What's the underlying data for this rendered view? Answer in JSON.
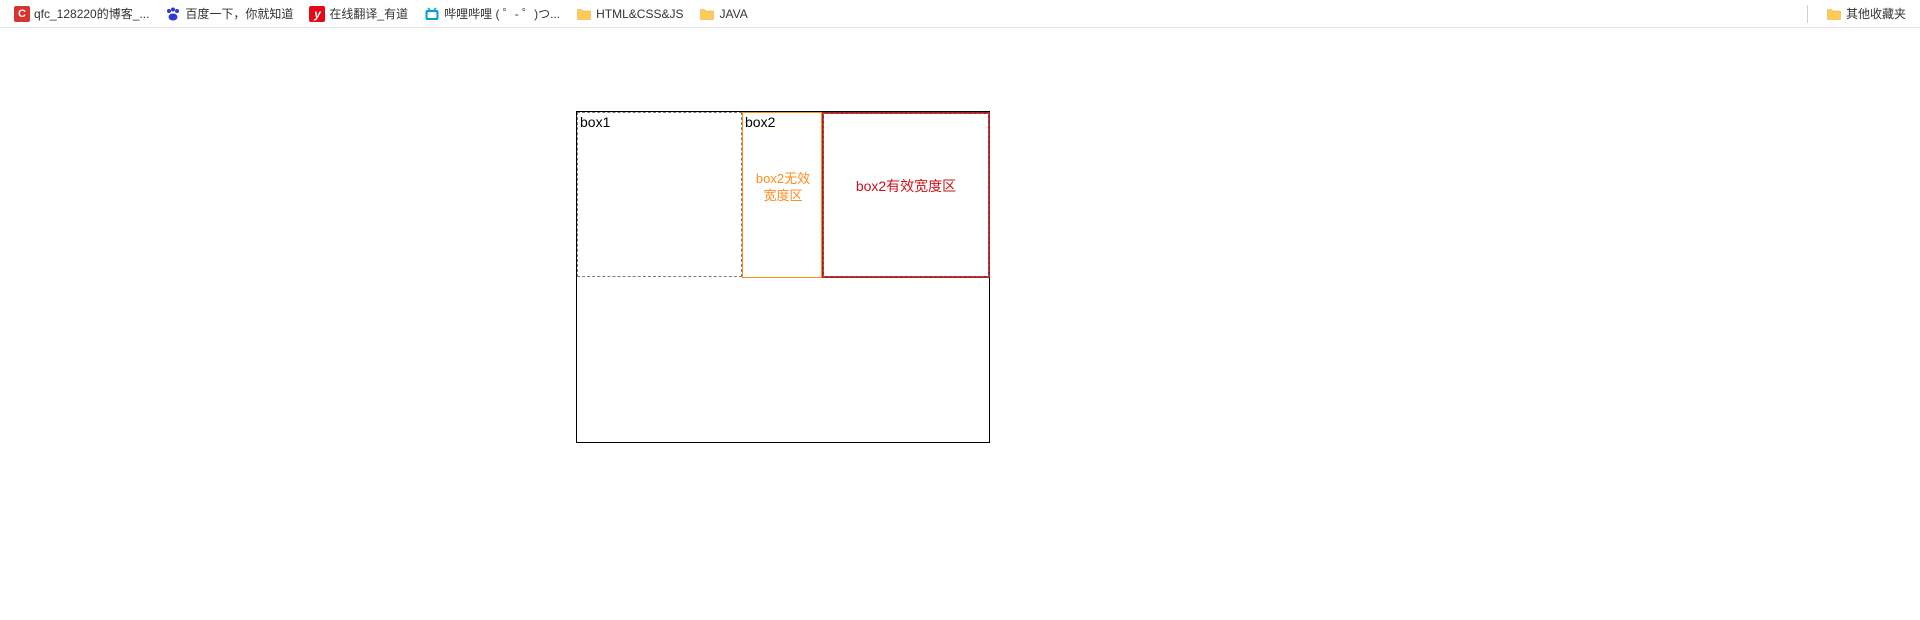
{
  "bookmarks": {
    "items": [
      {
        "label": "qfc_128220的博客_..."
      },
      {
        "label": "百度一下，你就知道"
      },
      {
        "label": "在线翻译_有道"
      },
      {
        "label": "哔哩哔哩 ( ゜- ゜)つ..."
      },
      {
        "label": "HTML&CSS&JS"
      },
      {
        "label": "JAVA"
      }
    ],
    "other": "其他收藏夹"
  },
  "content": {
    "box1_label": "box1",
    "box2_label": "box2",
    "box2_invalid_line1": "box2无效",
    "box2_invalid_line2": "宽度区",
    "box2_valid": "box2有效宽度区"
  }
}
